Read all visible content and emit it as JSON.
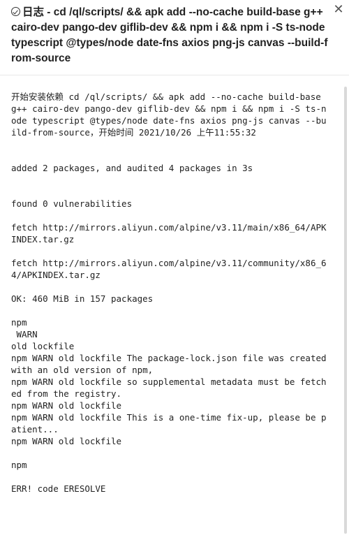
{
  "header": {
    "title": "日志 - cd /ql/scripts/ && apk add --no-cache build-base g++ cairo-dev pango-dev giflib-dev && npm i && npm i -S ts-node typescript @types/node date-fns axios png-js canvas --build-from-source",
    "status_icon": "check-circle-icon",
    "close_icon": "close-icon"
  },
  "log": {
    "lines": [
      "开始安装依赖 cd /ql/scripts/ && apk add --no-cache build-base g++ cairo-dev pango-dev giflib-dev && npm i && npm i -S ts-node typescript @types/node date-fns axios png-js canvas --build-from-source，开始时间 2021/10/26 上午11:55:32",
      "",
      "",
      "added 2 packages, and audited 4 packages in 3s",
      "",
      "",
      "found 0 vulnerabilities",
      "",
      "fetch http://mirrors.aliyun.com/alpine/v3.11/main/x86_64/APKINDEX.tar.gz",
      "",
      "fetch http://mirrors.aliyun.com/alpine/v3.11/community/x86_64/APKINDEX.tar.gz",
      "",
      "OK: 460 MiB in 157 packages",
      "",
      "npm",
      " WARN",
      "old lockfile",
      "npm WARN old lockfile The package-lock.json file was created with an old version of npm,",
      "npm WARN old lockfile so supplemental metadata must be fetched from the registry.",
      "npm WARN old lockfile",
      "npm WARN old lockfile This is a one-time fix-up, please be patient...",
      "npm WARN old lockfile",
      "",
      "npm",
      "",
      "ERR! code ERESOLVE"
    ]
  }
}
